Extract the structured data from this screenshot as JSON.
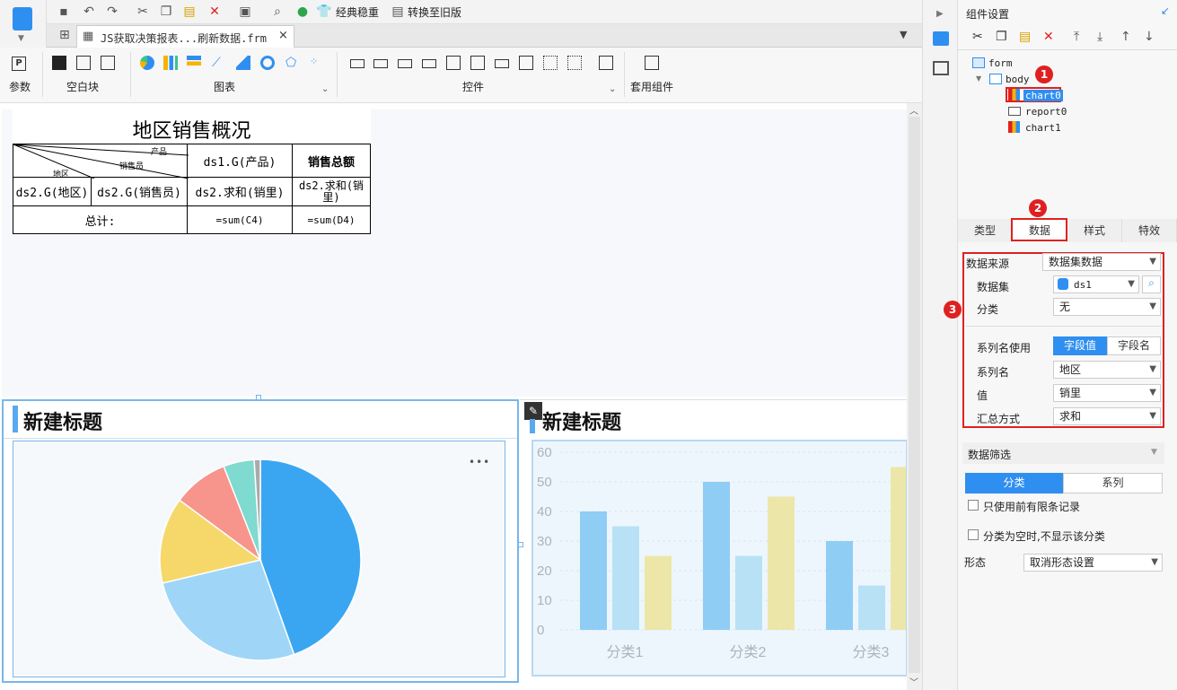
{
  "toolbar": {
    "classic_label": "经典稳重",
    "convert_label": "转换至旧版"
  },
  "tab": {
    "title": "JS获取决策报表...刷新数据.frm"
  },
  "ribbon": {
    "groups": [
      "参数",
      "空白块",
      "图表",
      "控件",
      "套用组件"
    ]
  },
  "report": {
    "title": "地区销售概况",
    "diag_top": "产品",
    "diag_mid": "销售员",
    "diag_bottom": "地区",
    "h_product": "ds1.G(产品)",
    "h_total": "销售总额",
    "c_region": "ds2.G(地区)",
    "c_seller": "ds2.G(销售员)",
    "c_sum1": "ds2.求和(销里)",
    "c_sum2": "ds2.求和(销里)",
    "f_total": "总计:",
    "f_sum1": "=sum(C4)",
    "f_sum2": "=sum(D4)"
  },
  "charts": {
    "left_title": "新建标题",
    "right_title": "新建标题",
    "more": "•••"
  },
  "chart_data": [
    {
      "type": "pie",
      "title": "新建标题",
      "values": [
        45,
        27,
        14,
        9,
        5,
        1
      ]
    },
    {
      "type": "bar",
      "title": "新建标题",
      "categories": [
        "分类1",
        "分类2",
        "分类3"
      ],
      "series": [
        {
          "values": [
            40,
            50,
            30
          ]
        },
        {
          "values": [
            35,
            25,
            15
          ]
        },
        {
          "values": [
            25,
            45,
            55
          ]
        }
      ],
      "ylim": [
        0,
        60
      ],
      "yticks": [
        "0",
        "10",
        "20",
        "30",
        "40",
        "50",
        "60"
      ]
    }
  ],
  "panel": {
    "title": "组件设置",
    "tree": {
      "form": "form",
      "body": "body",
      "chart0": "chart0",
      "report0": "report0",
      "chart1": "chart1"
    },
    "tabs": [
      "类型",
      "数据",
      "样式",
      "特效"
    ],
    "source_label": "数据来源",
    "source_value": "数据集数据",
    "dataset_label": "数据集",
    "dataset_value": "ds1",
    "category_label": "分类",
    "category_value": "无",
    "seriesname_use_label": "系列名使用",
    "btn_field_value": "字段值",
    "btn_field_name": "字段名",
    "seriesname_label": "系列名",
    "seriesname_value": "地区",
    "value_label": "值",
    "value_value": "销里",
    "agg_label": "汇总方式",
    "agg_value": "求和",
    "filter_label": "数据筛选",
    "filter_tab1": "分类",
    "filter_tab2": "系列",
    "check1": "只使用前有限条记录",
    "check2": "分类为空时,不显示该分类",
    "shape_label": "形态",
    "shape_value": "取消形态设置"
  },
  "badges": [
    "1",
    "2",
    "3"
  ],
  "colors": {
    "accent": "#2f8ff0",
    "red": "#e02020"
  }
}
